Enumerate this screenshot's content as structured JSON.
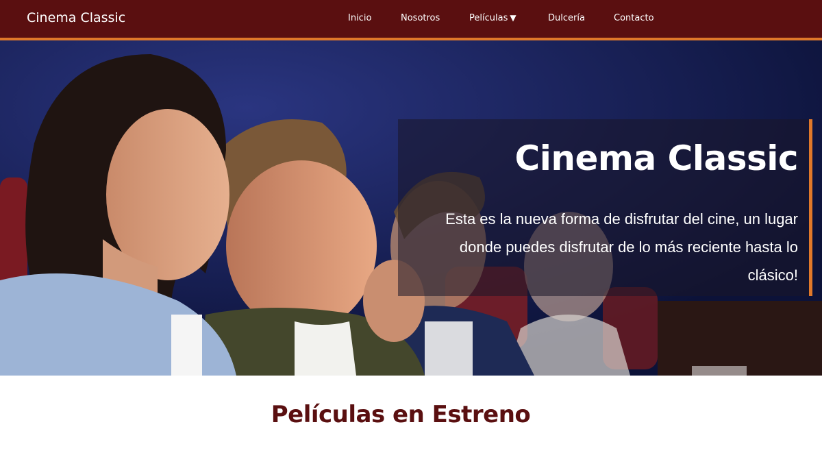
{
  "navbar": {
    "brand": "Cinema Classic",
    "links": [
      {
        "label": "Inicio"
      },
      {
        "label": "Nosotros"
      },
      {
        "label": "Películas",
        "caret": "▼"
      },
      {
        "label": "Dulcería"
      },
      {
        "label": "Contacto"
      }
    ],
    "colors": {
      "background": "#5a0f10",
      "accent": "#e0782a"
    }
  },
  "hero": {
    "title": "Cinema Classic",
    "text": "Esta es la nueva forma de disfrutar del cine, un lugar donde puedes disfrutar de lo más reciente hasta lo clásico!",
    "image_subject": "audience-watching-movie-photo"
  },
  "section": {
    "title": "Películas en Estreno",
    "color": "#5a0f10"
  }
}
